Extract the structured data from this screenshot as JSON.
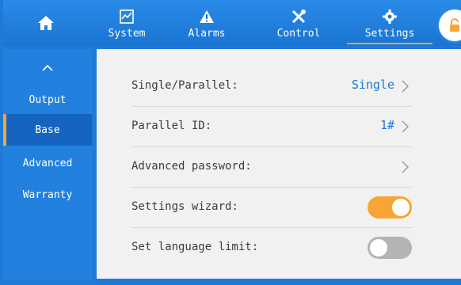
{
  "nav": {
    "home_icon": "home-icon",
    "tabs": [
      {
        "label": "System",
        "icon": "chart-icon"
      },
      {
        "label": "Alarms",
        "icon": "warning-icon"
      },
      {
        "label": "Control",
        "icon": "tools-icon"
      },
      {
        "label": "Settings",
        "icon": "gear-icon"
      }
    ],
    "active_tab": "Settings",
    "lock_icon": "lock-icon"
  },
  "sidebar": {
    "up_icon": "chevron-up-icon",
    "items": [
      {
        "label": "Output"
      },
      {
        "label": "Base"
      },
      {
        "label": "Advanced"
      },
      {
        "label": "Warranty"
      }
    ],
    "active_item": "Base"
  },
  "settings": {
    "rows": [
      {
        "label": "Single/Parallel:",
        "value": "Single"
      },
      {
        "label": "Parallel ID:",
        "value": "1#"
      },
      {
        "label": "Advanced password:",
        "value": ""
      },
      {
        "label": "Settings wizard:",
        "toggle": true
      },
      {
        "label": "Set language limit:",
        "toggle": false
      }
    ]
  },
  "colors": {
    "primary_blue": "#1e7ad6",
    "accent_orange": "#f7a534",
    "value_blue": "#1e77d0",
    "toggle_off": "#b4b4b4"
  }
}
